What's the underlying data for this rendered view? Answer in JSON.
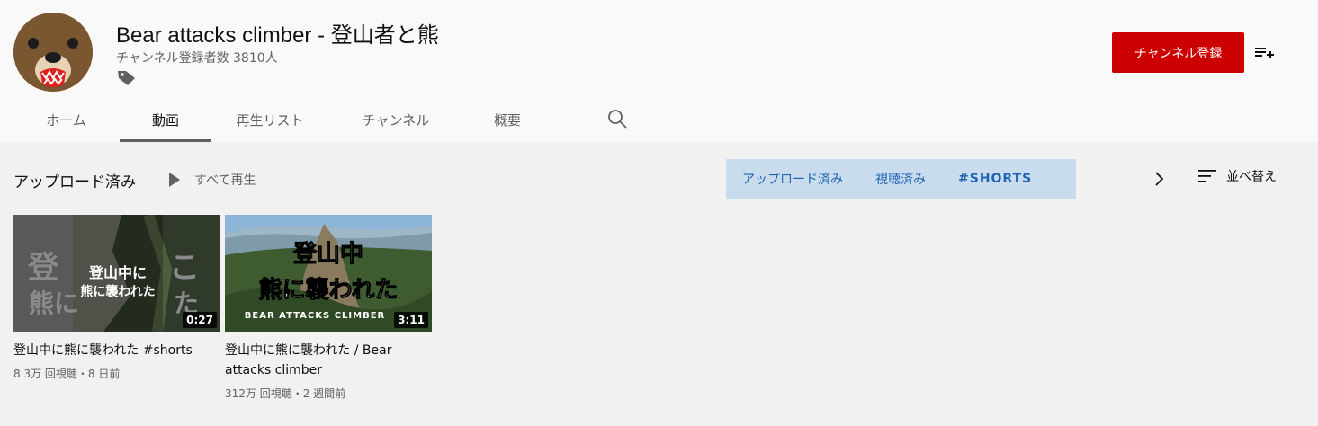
{
  "channel": {
    "name": "Bear attacks climber - 登山者と熊",
    "subscribers": "チャンネル登録者数 3810人",
    "subscribe_label": "チャンネル登録"
  },
  "tabs": [
    {
      "label": "ホーム"
    },
    {
      "label": "動画"
    },
    {
      "label": "再生リスト"
    },
    {
      "label": "チャンネル"
    },
    {
      "label": "概要"
    }
  ],
  "section": {
    "title": "アップロード済み",
    "play_all": "すべて再生"
  },
  "chips": [
    {
      "label": "アップロード済み"
    },
    {
      "label": "視聴済み"
    },
    {
      "label": "#SHORTS"
    }
  ],
  "sort_label": "並べ替え",
  "videos": [
    {
      "title": "登山中に熊に襲われた #shorts",
      "duration": "0:27",
      "meta": "8.3万 回視聴・8 日前",
      "thumb_text": [
        "登山中に",
        "熊に襲われた"
      ],
      "thumb_bg_text": [
        "登",
        "熊に",
        "こ",
        "た"
      ]
    },
    {
      "title": "登山中に熊に襲われた / Bear attacks climber",
      "duration": "3:11",
      "meta": "312万 回視聴・2 週間前",
      "thumb_text": [
        "登山中",
        "熊に襲われた",
        "BEAR ATTACKS CLIMBER"
      ]
    }
  ],
  "colors": {
    "accent_red": "#cc0000",
    "chip_bg": "#c9dcee",
    "chip_text": "#1f63b3"
  }
}
